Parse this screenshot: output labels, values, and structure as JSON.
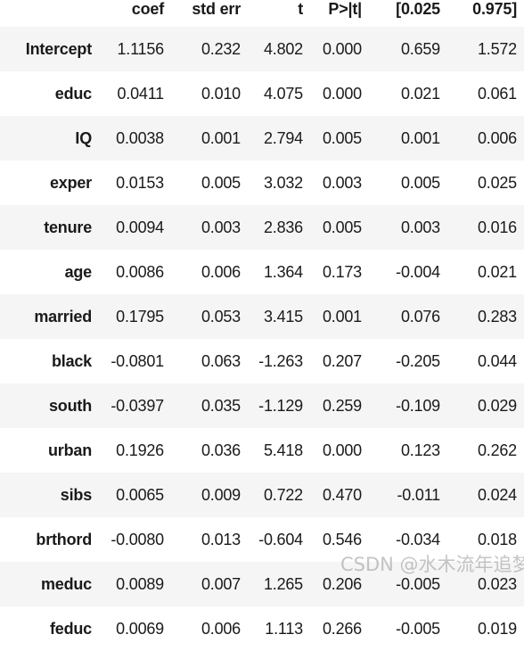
{
  "table": {
    "columns": [
      "",
      "coef",
      "std err",
      "t",
      "P>|t|",
      "[0.025",
      "0.975]"
    ],
    "rows": [
      {
        "label": "Intercept",
        "coef": "1.1156",
        "std_err": "0.232",
        "t": "4.802",
        "p": "0.000",
        "ci_low": "0.659",
        "ci_high": "1.572"
      },
      {
        "label": "educ",
        "coef": "0.0411",
        "std_err": "0.010",
        "t": "4.075",
        "p": "0.000",
        "ci_low": "0.021",
        "ci_high": "0.061"
      },
      {
        "label": "IQ",
        "coef": "0.0038",
        "std_err": "0.001",
        "t": "2.794",
        "p": "0.005",
        "ci_low": "0.001",
        "ci_high": "0.006"
      },
      {
        "label": "exper",
        "coef": "0.0153",
        "std_err": "0.005",
        "t": "3.032",
        "p": "0.003",
        "ci_low": "0.005",
        "ci_high": "0.025"
      },
      {
        "label": "tenure",
        "coef": "0.0094",
        "std_err": "0.003",
        "t": "2.836",
        "p": "0.005",
        "ci_low": "0.003",
        "ci_high": "0.016"
      },
      {
        "label": "age",
        "coef": "0.0086",
        "std_err": "0.006",
        "t": "1.364",
        "p": "0.173",
        "ci_low": "-0.004",
        "ci_high": "0.021"
      },
      {
        "label": "married",
        "coef": "0.1795",
        "std_err": "0.053",
        "t": "3.415",
        "p": "0.001",
        "ci_low": "0.076",
        "ci_high": "0.283"
      },
      {
        "label": "black",
        "coef": "-0.0801",
        "std_err": "0.063",
        "t": "-1.263",
        "p": "0.207",
        "ci_low": "-0.205",
        "ci_high": "0.044"
      },
      {
        "label": "south",
        "coef": "-0.0397",
        "std_err": "0.035",
        "t": "-1.129",
        "p": "0.259",
        "ci_low": "-0.109",
        "ci_high": "0.029"
      },
      {
        "label": "urban",
        "coef": "0.1926",
        "std_err": "0.036",
        "t": "5.418",
        "p": "0.000",
        "ci_low": "0.123",
        "ci_high": "0.262"
      },
      {
        "label": "sibs",
        "coef": "0.0065",
        "std_err": "0.009",
        "t": "0.722",
        "p": "0.470",
        "ci_low": "-0.011",
        "ci_high": "0.024"
      },
      {
        "label": "brthord",
        "coef": "-0.0080",
        "std_err": "0.013",
        "t": "-0.604",
        "p": "0.546",
        "ci_low": "-0.034",
        "ci_high": "0.018"
      },
      {
        "label": "meduc",
        "coef": "0.0089",
        "std_err": "0.007",
        "t": "1.265",
        "p": "0.206",
        "ci_low": "-0.005",
        "ci_high": "0.023"
      },
      {
        "label": "feduc",
        "coef": "0.0069",
        "std_err": "0.006",
        "t": "1.113",
        "p": "0.266",
        "ci_low": "-0.005",
        "ci_high": "0.019"
      }
    ]
  },
  "watermark": {
    "text": "CSDN @水木流年追梦"
  },
  "colors": {
    "stripe": "#f5f5f5",
    "background": "#ffffff",
    "text": "#1a1a1a"
  }
}
